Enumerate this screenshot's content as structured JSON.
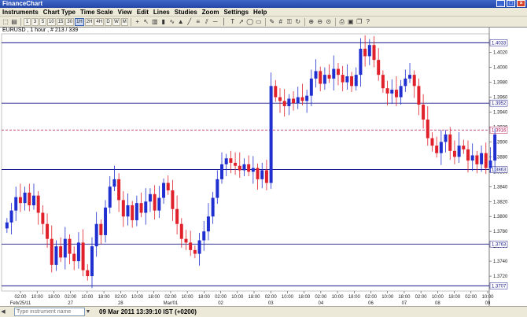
{
  "window": {
    "title": "FinanceChart",
    "minimize": "_",
    "maximize": "□",
    "close": "×"
  },
  "menu": [
    "Instruments",
    "Chart Type",
    "Time Scale",
    "View",
    "Edit",
    "Lines",
    "Studies",
    "Zoom",
    "Settings",
    "Help"
  ],
  "toolbar": {
    "timeframes": [
      "1",
      "3",
      "5",
      "10",
      "15",
      "30",
      "1H",
      "2H",
      "4H",
      "D",
      "W",
      "M"
    ],
    "active_timeframe": "1H"
  },
  "chart": {
    "symbol_label": "EURUSD , 1 hour , # 213 / 339",
    "colors": {
      "up": "#1f2fd0",
      "down": "#e0202a",
      "hline": "#1a1a8c",
      "current": "#b01050"
    },
    "chart_data": {
      "type": "candlestick",
      "y_range": [
        1.37,
        1.4045
      ],
      "y_ticks": [
        "1.4020",
        "1.4000",
        "1.3980",
        "1.3960",
        "1.3940",
        "1.3920",
        "1.3900",
        "1.3880",
        "1.3860",
        "1.3840",
        "1.3820",
        "1.3800",
        "1.3780",
        "1.3760",
        "1.3740",
        "1.3720"
      ],
      "horizontal_lines": [
        "1.4033",
        "1.3952",
        "1.3863",
        "1.3763",
        "1.3707"
      ],
      "current_price": "1.3916",
      "x_ticks": [
        {
          "label": "02:00",
          "day": "Feb/25/11"
        },
        {
          "label": "10:00"
        },
        {
          "label": "18:00"
        },
        {
          "label": "02:00",
          "day": "27"
        },
        {
          "label": "10:00"
        },
        {
          "label": "18:00"
        },
        {
          "label": "02:00",
          "day": "28"
        },
        {
          "label": "10:00"
        },
        {
          "label": "18:00"
        },
        {
          "label": "02:00",
          "day": "Mar/01"
        },
        {
          "label": "10:00"
        },
        {
          "label": "18:00"
        },
        {
          "label": "02:00",
          "day": "02"
        },
        {
          "label": "10:00"
        },
        {
          "label": "18:00"
        },
        {
          "label": "02:00",
          "day": "03"
        },
        {
          "label": "10:00"
        },
        {
          "label": "18:00"
        },
        {
          "label": "02:00",
          "day": "04"
        },
        {
          "label": "10:00"
        },
        {
          "label": "18:00"
        },
        {
          "label": "02:00",
          "day": "06"
        },
        {
          "label": "10:00"
        },
        {
          "label": "18:00",
          "day": "07"
        },
        {
          "label": "02:00"
        },
        {
          "label": "10:00",
          "day": "08"
        },
        {
          "label": "18:00"
        },
        {
          "label": "02:00"
        },
        {
          "label": "10:00",
          "day": "09"
        }
      ],
      "closes": [
        1.3792,
        1.3808,
        1.3826,
        1.3818,
        1.3832,
        1.3815,
        1.3828,
        1.3805,
        1.379,
        1.377,
        1.3735,
        1.376,
        1.3745,
        1.377,
        1.375,
        1.374,
        1.3765,
        1.3728,
        1.372,
        1.376,
        1.379,
        1.3775,
        1.3812,
        1.384,
        1.385,
        1.3822,
        1.38,
        1.3815,
        1.3795,
        1.3818,
        1.3805,
        1.382,
        1.383,
        1.3808,
        1.3825,
        1.3845,
        1.3835,
        1.381,
        1.379,
        1.377,
        1.3765,
        1.3755,
        1.375,
        1.3768,
        1.378,
        1.38,
        1.3825,
        1.385,
        1.387,
        1.3878,
        1.3872,
        1.3868,
        1.3862,
        1.387,
        1.386,
        1.3865,
        1.385,
        1.3862,
        1.3845,
        1.3975,
        1.396,
        1.3955,
        1.3948,
        1.3958,
        1.3952,
        1.396,
        1.3955,
        1.3962,
        1.3985,
        1.3995,
        1.3978,
        1.399,
        1.3985,
        1.3998,
        1.399,
        1.398,
        1.3988,
        1.3975,
        1.399,
        1.4025,
        1.4015,
        1.403,
        1.401,
        1.399,
        1.3972,
        1.3965,
        1.397,
        1.396,
        1.3975,
        1.3985,
        1.399,
        1.3975,
        1.395,
        1.393,
        1.3905,
        1.3895,
        1.3885,
        1.39,
        1.391,
        1.3888,
        1.388,
        1.3895,
        1.389,
        1.3875,
        1.3882,
        1.387,
        1.3885,
        1.3865,
        1.3875,
        1.391
      ]
    }
  },
  "status": {
    "instrument_placeholder": "Type instrument name",
    "datetime": "09 Mar 2011 13:39:10  IST (+0200)"
  }
}
